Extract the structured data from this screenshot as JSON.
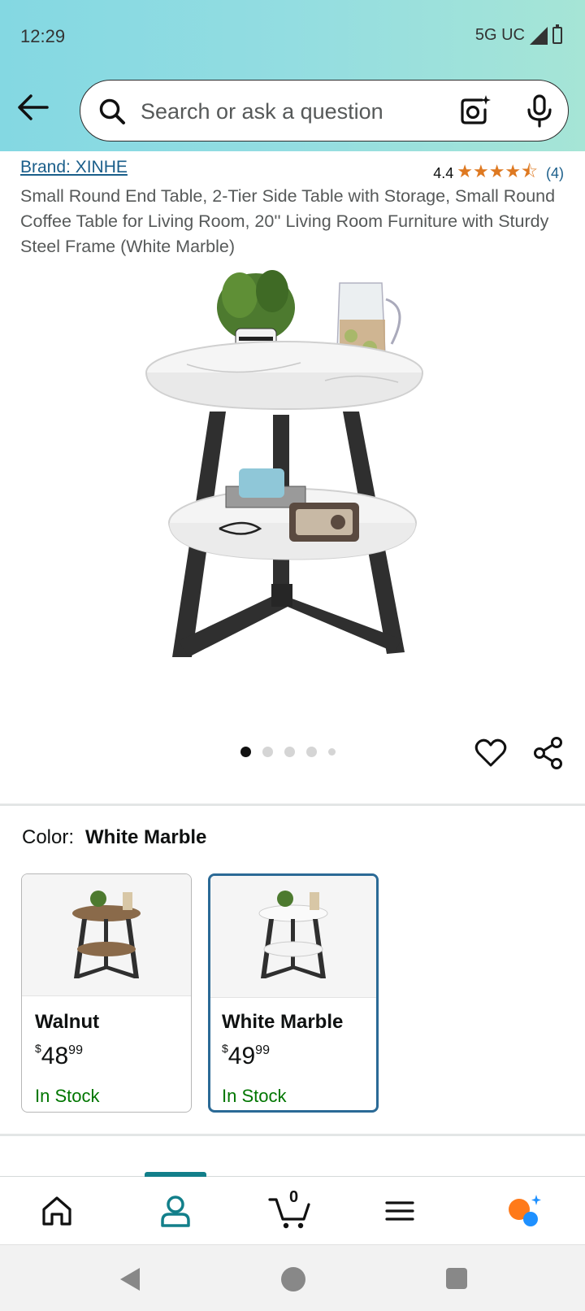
{
  "status_bar": {
    "time": "12:29",
    "network": "5G UC"
  },
  "search": {
    "placeholder": "Search or ask a question"
  },
  "product": {
    "brand": "Brand: XINHE",
    "rating": "4.4",
    "rating_stars": "★★★★⯪",
    "review_count": "(4)",
    "title": "Small Round End Table, 2-Tier Side Table with Storage, Small Round Coffee Table for Living Room, 20'' Living Room Furniture with Sturdy Steel Frame (White Marble)"
  },
  "carousel": {
    "image_count": 5,
    "active_index": 0
  },
  "color": {
    "label": "Color:",
    "selected": "White Marble",
    "options": [
      {
        "name": "Walnut",
        "currency": "$",
        "dollars": "48",
        "cents": "99",
        "stock": "In Stock",
        "top_color": "#8a6a4a"
      },
      {
        "name": "White Marble",
        "currency": "$",
        "dollars": "49",
        "cents": "99",
        "stock": "In Stock",
        "top_color": "#f3f3f3"
      }
    ]
  },
  "bottom_nav": {
    "cart_count": "0",
    "active": "account"
  },
  "colors": {
    "accent": "#127f8a",
    "link": "#1a5e8a",
    "in_stock": "#007600",
    "star": "#de7921",
    "selected_border": "#2b6a96"
  }
}
